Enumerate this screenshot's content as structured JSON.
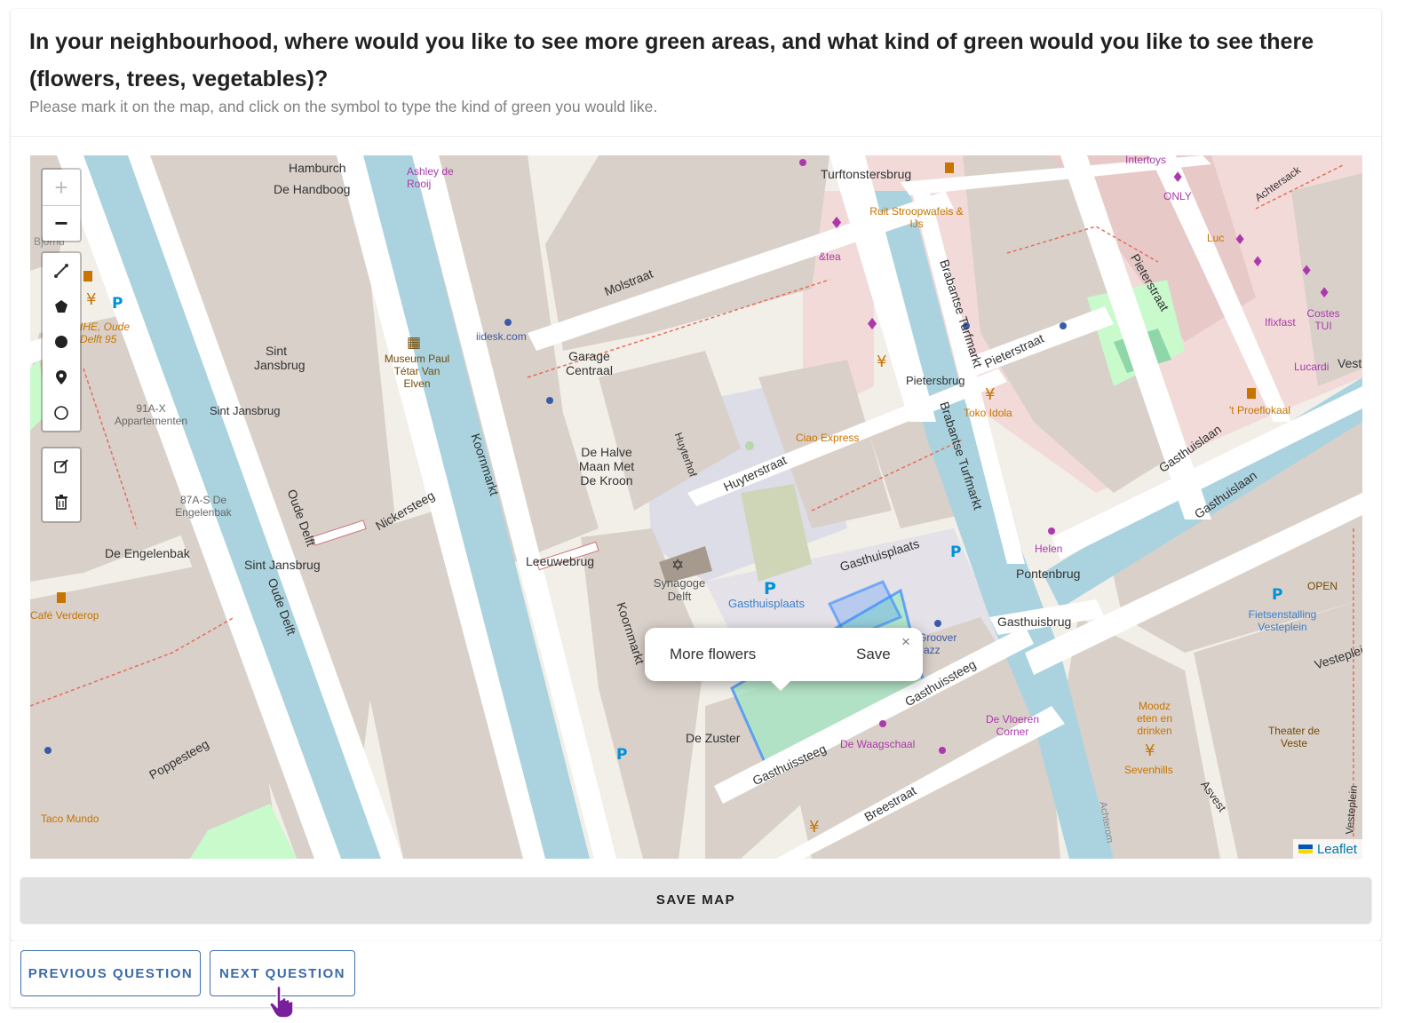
{
  "question": {
    "title": "In your neighbourhood, where would you like to see more green areas, and what kind of green would you like to see there (flowers, trees, vegetables)?",
    "subtitle": "Please mark it on the map, and click on the symbol to type the kind of green you would like."
  },
  "map": {
    "attribution": "Leaflet",
    "zoom_controls": {
      "zoom_in": "+",
      "zoom_out": "−"
    },
    "draw_tools": [
      "polyline-tool",
      "polygon-tool",
      "circle-marker-tool",
      "marker-tool",
      "circle-tool"
    ],
    "edit_tools": [
      "edit-layers-tool",
      "delete-layers-tool"
    ],
    "popup": {
      "text": "More flowers",
      "save": "Save",
      "close": "×"
    },
    "labels": {
      "hamburch": "Hamburch",
      "handboog": "De Handboog",
      "ashley": "Ashley de Rooij",
      "turftonstersbrug": "Turftonstersbrug",
      "ruit": "Ruit Stroopwafels & IJs",
      "intertoys": "Intertoys",
      "only": "ONLY",
      "achtersack": "Achtersack",
      "luc": "Luc",
      "molstraat": "Molstraat",
      "tea": "&tea",
      "brabantse1": "Brabantse Turfmarkt",
      "brabantse2": "Brabantse Turfmarkt",
      "pietersstraat1": "Pieterstraat",
      "pietersstraat2": "Pieterstraat",
      "ifixfast": "Ifixfast",
      "costes": "Costes TUI",
      "lucardi": "Lucardi",
      "vest": "Vest",
      "proeflokaal": "'t Proeflokaal",
      "bjornd": "Bjornd",
      "ihe": "IHE, Oude Delft 95",
      "sintjansbrug": "Sint Jansbrug",
      "sintjansbrug2": "Sint Jansbrug",
      "sintjansbrug3": "Sint Jansbrug",
      "museum": "Museum Paul Tétar Van Elven",
      "iidesk": "iidesk.com",
      "garage": "Garage Centraal",
      "pietersbrug": "Pietersbrug",
      "tokoidola": "Toko Idola",
      "gasthuislaan1": "Gasthuislaan",
      "gasthuislaan2": "Gasthuislaan",
      "appartementen": "91A-X Appartementen",
      "engelenbak1": "87A-S De Engelenbak",
      "engelenbak2": "De Engelenbak",
      "halvemaan": "De Halve Maan Met De Kroon",
      "huyterhof": "Huyterhof",
      "huyterstraat": "Huyterstraat",
      "ciao": "Ciao Express",
      "koornmarkt1": "Koornmarkt",
      "koornmarkt2": "Koornmarkt",
      "oudedelft1": "Oude Delft",
      "oudedelft2": "Oude Delft",
      "nickersteeg": "Nickersteeg",
      "leeuwebrug": "Leeuwebrug",
      "synagoge": "Synagoge Delft",
      "gasthuisplaats": "Gasthuisplaats",
      "gasthuisplaats2": "Gasthuisplaats",
      "helen": "Helen",
      "pontenbrug": "Pontenbrug",
      "gasthuisbrug": "Gasthuisbrug",
      "open": "OPEN",
      "fietsenstalling": "Fietsenstalling Vesteplein",
      "vesteplein": "Vesteplein",
      "groover": "Groover Jazz",
      "gasthuissteeg1": "Gasthuissteeg",
      "gasthuissteeg2": "Gasthuissteeg",
      "cafe": "Café Verderop",
      "dezuster": "De Zuster",
      "waagschaal": "De Waagschaal",
      "vloeren": "De Vloeren Corner",
      "moodz": "Moodz eten en drinken",
      "theater": "Theater de Veste",
      "sevenhills": "Sevenhills",
      "poppesteeg": "Poppesteeg",
      "breestraat": "Breestraat",
      "asvest": "Asvest",
      "taco": "Taco Mundo",
      "achterom": "Achterom",
      "vesteplein2": "Vesteplein"
    }
  },
  "actions": {
    "save_map": "SAVE MAP",
    "previous": "PREVIOUS QUESTION",
    "next": "NEXT QUESTION"
  },
  "colors": {
    "canal": "#aad3df",
    "building": "#d9d0c9",
    "road": "#ffffff",
    "pedestrian": "#dddde8",
    "shop_area": "#f2dad9",
    "park": "#c8facc",
    "drawn_shape": "#3388ff",
    "button_blue": "#3a6aa9"
  }
}
